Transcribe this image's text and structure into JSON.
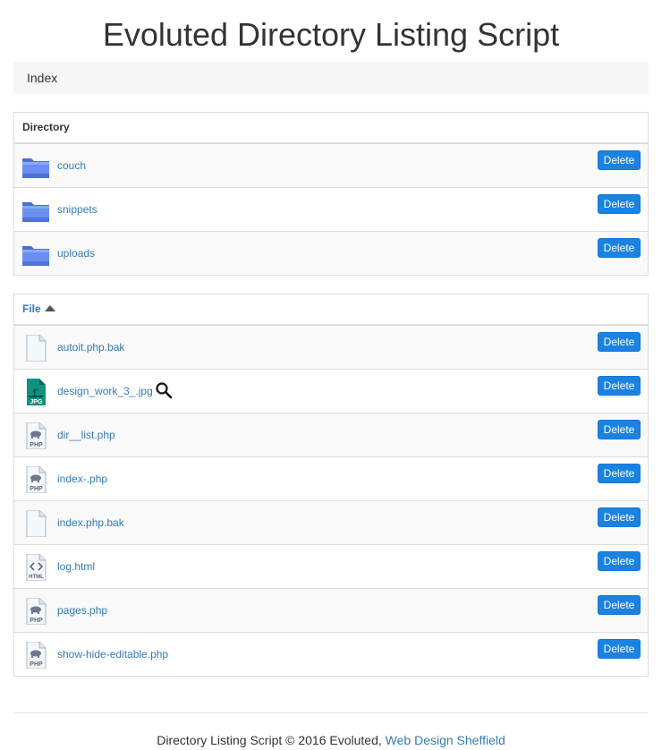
{
  "page": {
    "title": "Evoluted Directory Listing Script"
  },
  "breadcrumb": {
    "label": "Index"
  },
  "directories": {
    "header": "Directory",
    "delete_label": "Delete",
    "items": [
      {
        "name": "couch",
        "icon": "folder-icon"
      },
      {
        "name": "snippets",
        "icon": "folder-icon"
      },
      {
        "name": "uploads",
        "icon": "folder-icon"
      }
    ]
  },
  "files": {
    "header": "File",
    "sort": "ascending",
    "delete_label": "Delete",
    "items": [
      {
        "name": "autoit.php.bak",
        "icon": "blank-file-icon"
      },
      {
        "name": "design_work_3_.jpg",
        "icon": "jpg-file-icon",
        "preview": true
      },
      {
        "name": "dir__list.php",
        "icon": "php-file-icon"
      },
      {
        "name": "index-.php",
        "icon": "php-file-icon"
      },
      {
        "name": "index.php.bak",
        "icon": "blank-file-icon"
      },
      {
        "name": "log.html",
        "icon": "html-file-icon"
      },
      {
        "name": "pages.php",
        "icon": "php-file-icon"
      },
      {
        "name": "show-hide-editable.php",
        "icon": "php-file-icon"
      }
    ]
  },
  "footer": {
    "text": "Directory Listing Script © 2016 Evoluted, ",
    "link_label": "Web Design Sheffield"
  },
  "colors": {
    "accent": "#337ab7",
    "button": "#1a82e2",
    "folder": "#5b7fe6",
    "jpg": "#0f8a7a"
  }
}
